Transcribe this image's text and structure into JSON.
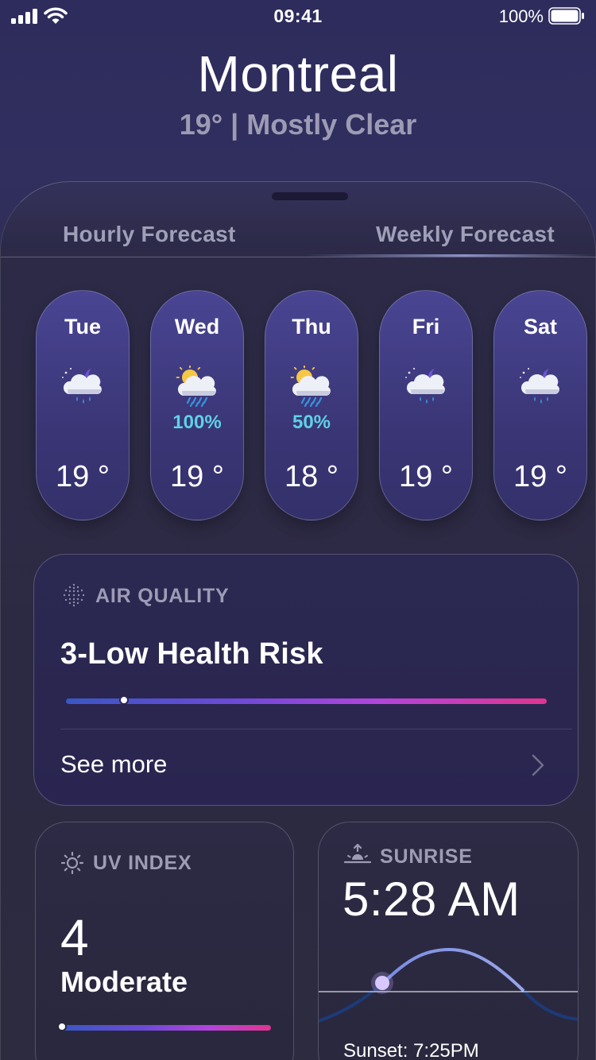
{
  "status_bar": {
    "time": "09:41",
    "battery_percent": "100%",
    "icons": [
      "signal-icon",
      "wifi-icon",
      "battery-icon"
    ]
  },
  "header": {
    "city": "Montreal",
    "summary": "19° | Mostly Clear"
  },
  "tabs": [
    {
      "label": "Hourly Forecast",
      "active": false
    },
    {
      "label": "Weekly Forecast",
      "active": true
    }
  ],
  "weekly": [
    {
      "day": "Tue",
      "icon": "moon-cloud-rain-icon",
      "chance": "",
      "temp": "19 °"
    },
    {
      "day": "Wed",
      "icon": "sun-cloud-heavy-rain-icon",
      "chance": "100%",
      "temp": "19 °"
    },
    {
      "day": "Thu",
      "icon": "sun-cloud-heavy-rain-icon",
      "chance": "50%",
      "temp": "18 °"
    },
    {
      "day": "Fri",
      "icon": "moon-cloud-rain-icon",
      "chance": "",
      "temp": "19 °"
    },
    {
      "day": "Sat",
      "icon": "moon-cloud-rain-icon",
      "chance": "",
      "temp": "19 °"
    }
  ],
  "air_quality": {
    "label": "AIR QUALITY",
    "value": "3-Low Health Risk",
    "level_fraction": 0.12,
    "see_more": "See more"
  },
  "uv_index": {
    "label": "UV INDEX",
    "value": "4",
    "description": "Moderate",
    "level_fraction": 0.0
  },
  "sunrise": {
    "label": "SUNRISE",
    "time": "5:28 AM",
    "sunset": "Sunset: 7:25PM"
  },
  "colors": {
    "accent_rain": "#5fd1e6",
    "gradient_start": "#3a57c4",
    "gradient_end": "#e0358f"
  }
}
